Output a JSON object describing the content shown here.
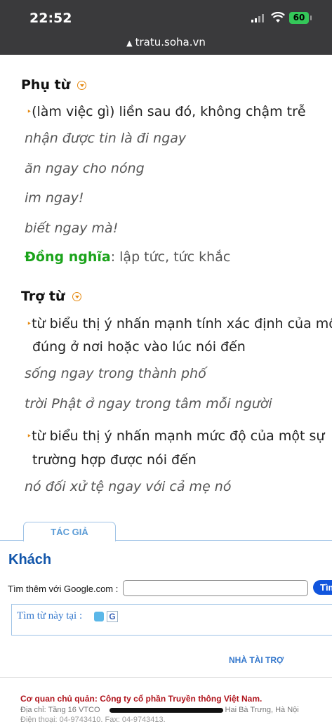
{
  "status_bar": {
    "time": "22:52",
    "battery": "60",
    "url": "tratu.soha.vn"
  },
  "sections": {
    "phu_tu": {
      "heading": "Phụ từ",
      "definition": "(làm việc gì) liền sau đó, không chậm trễ",
      "examples": [
        "nhận được tin là đi ngay",
        "ăn ngay cho nóng",
        "im ngay!",
        "biết ngay mà!"
      ],
      "synonym_label": "Đồng nghĩa",
      "synonym_colon": ":",
      "synonyms": " lập tức, tức khắc"
    },
    "tro_tu": {
      "heading": "Trợ từ",
      "def1_line1": "từ biểu thị ý nhấn mạnh tính xác định của mộ",
      "def1_line2": "đúng ở nơi hoặc vào lúc nói đến",
      "examples1": [
        "sống ngay trong thành phố",
        "trời Phật ở ngay trong tâm mỗi người"
      ],
      "def2_line1": "từ biểu thị ý nhấn mạnh mức độ của một sự",
      "def2_line2": "trường hợp được nói đến",
      "examples2": [
        "nó đối xử tệ ngay với cả mẹ nó"
      ]
    }
  },
  "author_tab": {
    "label": "TÁC GIẢ",
    "name": "Khách"
  },
  "search": {
    "label": "Tìm thêm với Google.com :",
    "button": "Tìm",
    "value": ""
  },
  "find": {
    "label": "Tìm từ này tại :"
  },
  "sponsor": "NHÀ TÀI TRỢ",
  "footer": {
    "line1": "Cơ quan chủ quản: Công ty cổ phần Truyền thông Việt Nam.",
    "line2_start": "Địa chỉ: Tầng 16 VTCO",
    "line2_end": "Hai Bà Trưng, Hà Nội",
    "line3": "Điện thoại: 04-9743410. Fax: 04-9743413."
  }
}
